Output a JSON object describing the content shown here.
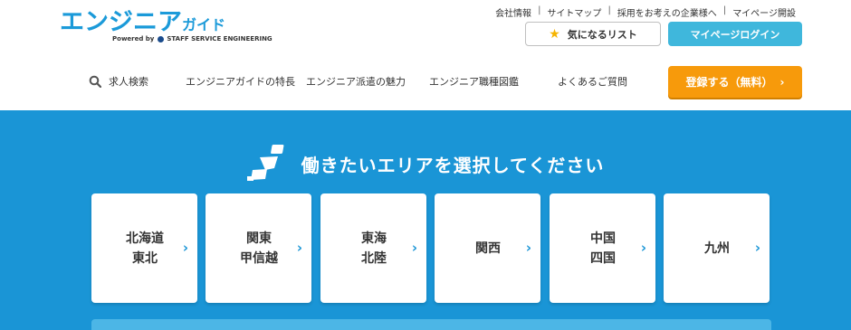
{
  "logo": {
    "main": "エンジニア",
    "main_small": "ガイド",
    "sub_prefix": "Powered by",
    "sub_company": "STAFF SERVICE ENGINEERING"
  },
  "util_links": [
    "会社情報",
    "サイトマップ",
    "採用をお考えの企業様へ",
    "マイページ開設"
  ],
  "util_sep": "|",
  "buttons": {
    "favorites": "気になるリスト",
    "mypage_login": "マイページログイン",
    "register": "登録する（無料）",
    "register_chevron": "›"
  },
  "nav": {
    "search": "求人検索",
    "features": "エンジニアガイドの特長",
    "dispatch": "エンジニア派遣の魅力",
    "jobs": "エンジニア職種図鑑",
    "faq": "よくあるご質問"
  },
  "area": {
    "title": "働きたいエリアを選択してください",
    "chevron": "›",
    "regions": [
      {
        "line1": "北海道",
        "line2": "東北"
      },
      {
        "line1": "関東",
        "line2": "甲信越"
      },
      {
        "line1": "東海",
        "line2": "北陸"
      },
      {
        "line1": "関西",
        "line2": ""
      },
      {
        "line1": "中国",
        "line2": "四国"
      },
      {
        "line1": "九州",
        "line2": ""
      }
    ]
  },
  "colors": {
    "brand_blue": "#1a95d6",
    "mypage_button": "#3fb7dc",
    "register_button": "#f79a0b",
    "star": "#f5b400"
  }
}
